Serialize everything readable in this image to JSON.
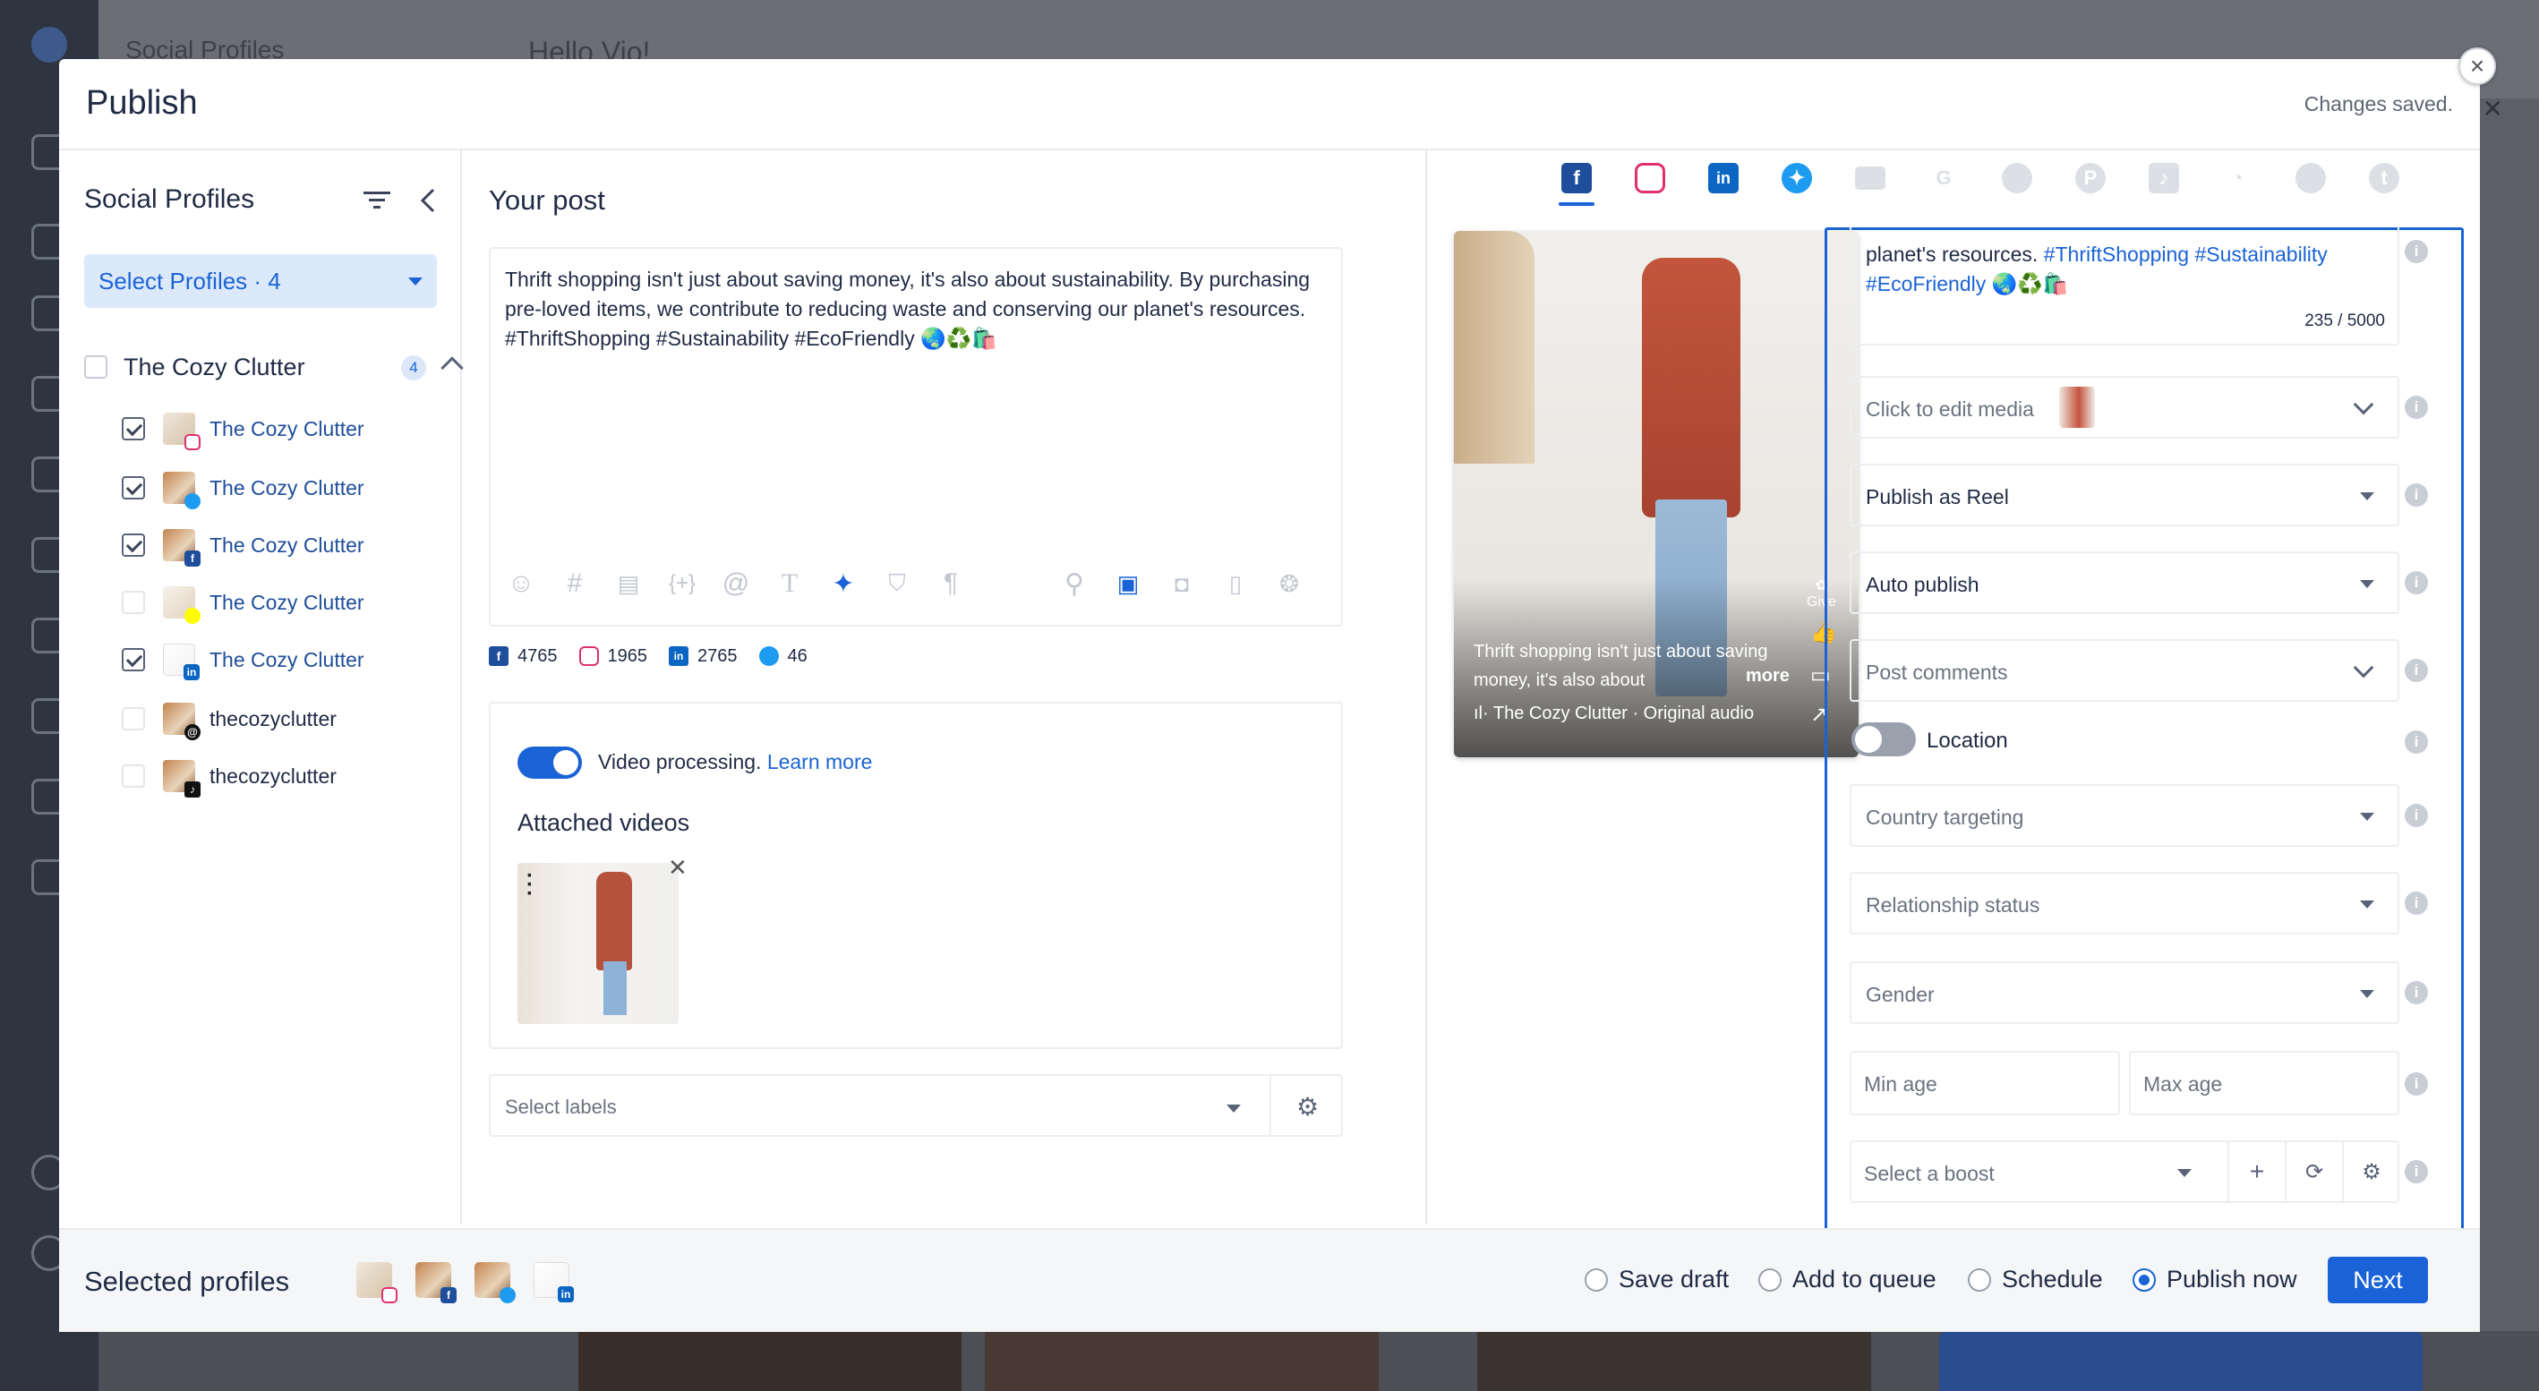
{
  "background": {
    "title_left": "Social Profiles",
    "title_right": "Hello Vio!"
  },
  "modal": {
    "title": "Publish",
    "status": "Changes saved.",
    "close_icon": "close-icon"
  },
  "profiles_panel": {
    "title": "Social Profiles",
    "select_label": "Select Profiles · 4",
    "group": {
      "name": "The Cozy Clutter",
      "count": "4"
    },
    "items": [
      {
        "name": "The Cozy Clutter",
        "network": "instagram",
        "checked": true
      },
      {
        "name": "The Cozy Clutter",
        "network": "twitter",
        "checked": true
      },
      {
        "name": "The Cozy Clutter",
        "network": "facebook",
        "checked": true
      },
      {
        "name": "The Cozy Clutter",
        "network": "snapchat",
        "checked": false
      },
      {
        "name": "The Cozy Clutter",
        "network": "linkedin",
        "checked": true
      },
      {
        "name": "thecozyclutter",
        "network": "threads",
        "checked": false
      },
      {
        "name": "thecozyclutter",
        "network": "tiktok",
        "checked": false
      }
    ]
  },
  "post": {
    "title": "Your post",
    "text": "Thrift shopping isn't just about saving money, it's also about sustainability. By purchasing pre-loved items, we contribute to reducing waste and conserving our planet's resources. #ThriftShopping #Sustainability #EcoFriendly 🌏♻️🛍️",
    "toolbar_icons": [
      "emoji-icon",
      "hashtag-icon",
      "template-icon",
      "variable-icon",
      "mention-icon",
      "text-format-icon",
      "ai-wand-icon",
      "shield-icon",
      "paragraph-icon",
      "link-icon",
      "video-icon",
      "camera-icon",
      "document-icon",
      "gif-icon"
    ],
    "counts": [
      {
        "network": "facebook",
        "value": "4765"
      },
      {
        "network": "instagram",
        "value": "1965"
      },
      {
        "network": "linkedin",
        "value": "2765"
      },
      {
        "network": "twitter",
        "value": "46"
      }
    ],
    "video_processing": {
      "text": "Video processing.",
      "link": "Learn more",
      "on": true
    },
    "attached_title": "Attached videos",
    "labels_placeholder": "Select labels"
  },
  "preview": {
    "tabs": [
      "facebook",
      "instagram",
      "linkedin",
      "twitter",
      "youtube",
      "google",
      "reddit",
      "pinterest",
      "tiktok",
      "snapchat",
      "threads",
      "tumblr"
    ],
    "active_tab": "facebook",
    "caption": "Thrift shopping isn't just about saving money, it's also about",
    "more": "more",
    "audio": "The Cozy Clutter · Original audio",
    "give": "Give"
  },
  "settings": {
    "text_excerpt_plain": "planet's resources. ",
    "text_excerpt_tags": "#ThriftShopping #Sustainability",
    "text_excerpt_line2": "#EcoFriendly 🌏♻️🛍️",
    "char_count": "235 / 5000",
    "edit_media": "Click to edit media",
    "publish_as": "Publish as Reel",
    "auto_publish": "Auto publish",
    "post_comments": "Post comments",
    "location": {
      "label": "Location",
      "on": false
    },
    "country_targeting": "Country targeting",
    "relationship_status": "Relationship status",
    "gender": "Gender",
    "min_age": "Min age",
    "max_age": "Max age",
    "boost": "Select a boost"
  },
  "footer": {
    "selected_title": "Selected profiles",
    "options": [
      {
        "label": "Save draft",
        "selected": false
      },
      {
        "label": "Add to queue",
        "selected": false
      },
      {
        "label": "Schedule",
        "selected": false
      },
      {
        "label": "Publish now",
        "selected": true
      }
    ],
    "next_label": "Next"
  },
  "colors": {
    "accent": "#1a63d6",
    "text": "#1f2a44",
    "facebook": "#1f4e9c",
    "instagram": "#e1306c",
    "linkedin": "#0a66c2",
    "twitter": "#1d9bf0"
  }
}
